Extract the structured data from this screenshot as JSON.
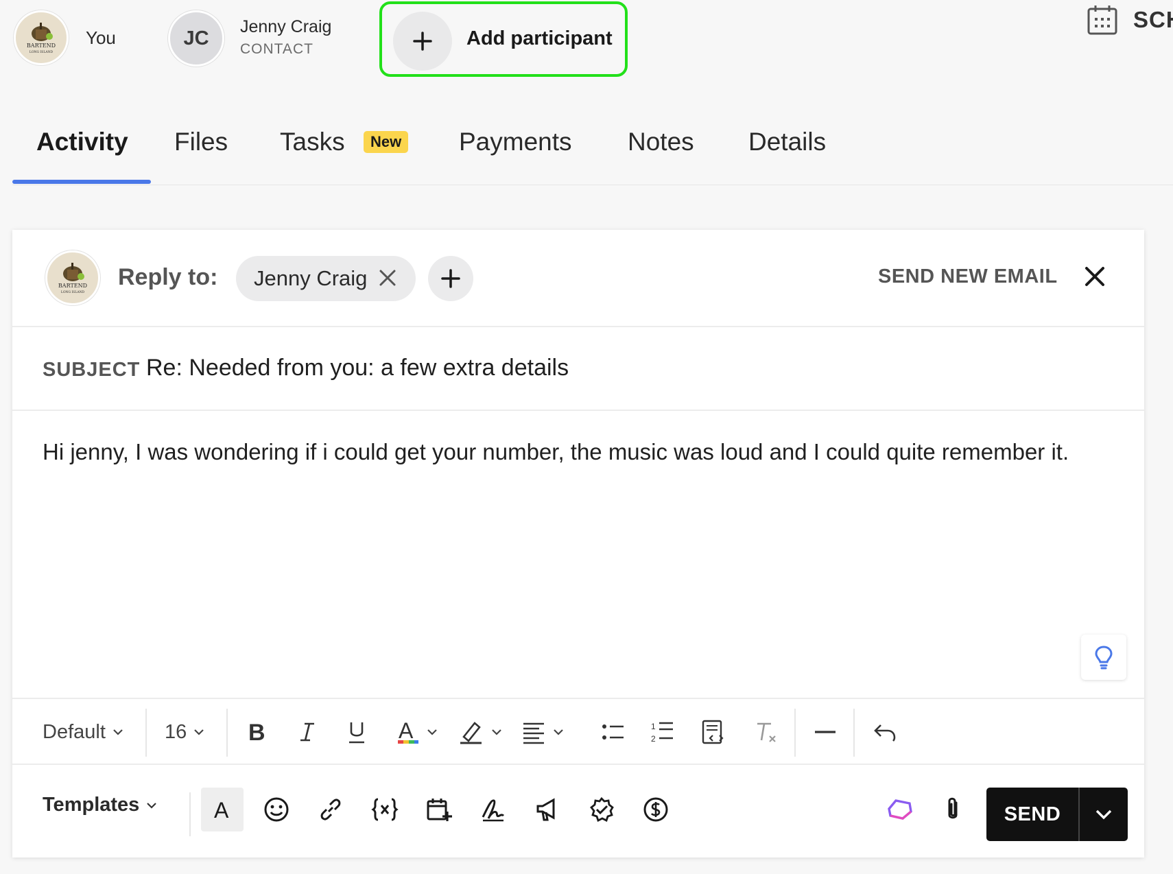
{
  "participants": {
    "you_label": "You",
    "contact_initials": "JC",
    "contact_name": "Jenny Craig",
    "contact_role": "CONTACT",
    "add_participant_label": "Add participant",
    "schedule_label": "SCH",
    "logo_text": "BARTEND",
    "logo_subtext": "LONG ISLAND"
  },
  "tabs": [
    {
      "label": "Activity",
      "active": true
    },
    {
      "label": "Files"
    },
    {
      "label": "Tasks",
      "badge": "New"
    },
    {
      "label": "Payments"
    },
    {
      "label": "Notes"
    },
    {
      "label": "Details"
    }
  ],
  "composer": {
    "reply_label": "Reply to:",
    "recipient": "Jenny Craig",
    "send_new_email": "SEND NEW EMAIL",
    "subject_label": "SUBJECT",
    "subject": "Re: Needed from you: a few extra details",
    "body": "Hi jenny, I was wondering if i could get your number, the music was loud and I could quite remember it."
  },
  "toolbar": {
    "font_family": "Default",
    "font_size": "16",
    "tools": [
      "bold-icon",
      "italic-icon",
      "underline-icon",
      "text-color-icon",
      "highlight-icon",
      "align-icon",
      "bulleted-list-icon",
      "numbered-list-icon",
      "html-source-icon",
      "clear-format-icon",
      "horizontal-rule-icon",
      "undo-icon"
    ]
  },
  "actions": {
    "templates_label": "Templates",
    "format_letter": "A",
    "icons": [
      "text-format-icon",
      "emoji-icon",
      "link-icon",
      "variable-icon",
      "schedule-meeting-icon",
      "signature-icon",
      "announcement-icon",
      "verified-badge-icon",
      "payment-icon",
      "ai-assistant-icon",
      "attachment-icon"
    ],
    "send_label": "SEND"
  },
  "colors": {
    "accent": "#4a78e8",
    "highlight_border": "#22e01a",
    "badge": "#fbd54d",
    "send": "#111111"
  }
}
